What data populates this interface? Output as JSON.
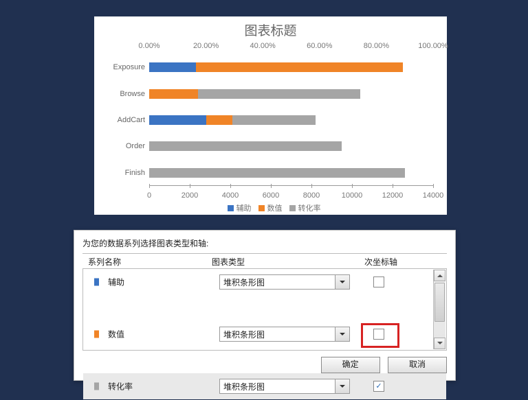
{
  "chart_data": {
    "type": "bar",
    "title": "图表标题",
    "orientation": "horizontal",
    "categories": [
      "Exposure",
      "Browse",
      "AddCart",
      "Order",
      "Finish"
    ],
    "series": [
      {
        "name": "辅助",
        "color": "#3b74c3",
        "values": [
          2300,
          0,
          2800,
          0,
          0
        ]
      },
      {
        "name": "数值",
        "color": "#f08427",
        "values": [
          10200,
          2400,
          1300,
          0,
          0
        ]
      },
      {
        "name": "转化率",
        "color": "#a5a5a5",
        "values": [
          0,
          8000,
          4100,
          9500,
          12600
        ]
      }
    ],
    "primary_axis": {
      "label": "",
      "min": 0,
      "max": 14000,
      "ticks": [
        0,
        2000,
        4000,
        6000,
        8000,
        10000,
        12000,
        14000
      ]
    },
    "secondary_axis": {
      "label": "",
      "min": 0,
      "max": 1.0,
      "ticks_pct": [
        "0.00%",
        "20.00%",
        "40.00%",
        "60.00%",
        "80.00%",
        "100.00%"
      ]
    },
    "legend": [
      "辅助",
      "数值",
      "转化率"
    ]
  },
  "dialog": {
    "title": "为您的数据系列选择图表类型和轴:",
    "headers": {
      "name": "系列名称",
      "type": "图表类型",
      "secondary": "次坐标轴"
    },
    "chart_type_option": "堆积条形图",
    "rows": [
      {
        "name": "辅助",
        "color": "#3b74c3",
        "secondary": false,
        "selected": false
      },
      {
        "name": "数值",
        "color": "#f08427",
        "secondary": false,
        "selected": false
      },
      {
        "name": "转化率",
        "color": "#a5a5a5",
        "secondary": true,
        "selected": true
      }
    ],
    "buttons": {
      "ok": "确定",
      "cancel": "取消"
    }
  }
}
